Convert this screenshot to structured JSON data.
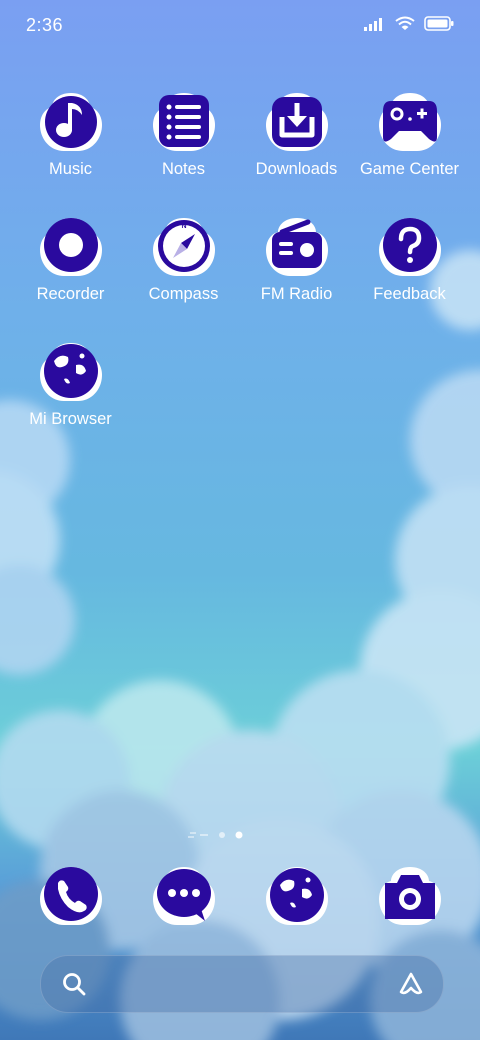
{
  "status_bar": {
    "time": "2:36"
  },
  "apps": [
    {
      "label": "Music",
      "icon": "music-note-icon"
    },
    {
      "label": "Notes",
      "icon": "notes-list-icon"
    },
    {
      "label": "Downloads",
      "icon": "download-icon"
    },
    {
      "label": "Game Center",
      "icon": "gamepad-icon"
    },
    {
      "label": "Recorder",
      "icon": "record-icon"
    },
    {
      "label": "Compass",
      "icon": "compass-icon"
    },
    {
      "label": "FM Radio",
      "icon": "radio-icon"
    },
    {
      "label": "Feedback",
      "icon": "question-icon"
    },
    {
      "label": "Mi Browser",
      "icon": "globe-icon"
    }
  ],
  "page_indicator": {
    "pages": 2,
    "current": 2
  },
  "dock": [
    "phone-icon",
    "messages-icon",
    "globe-icon",
    "camera-icon"
  ],
  "colors": {
    "icon_fill": "#2a0a9e",
    "badge": "#ffffff",
    "text": "#ffffff"
  }
}
